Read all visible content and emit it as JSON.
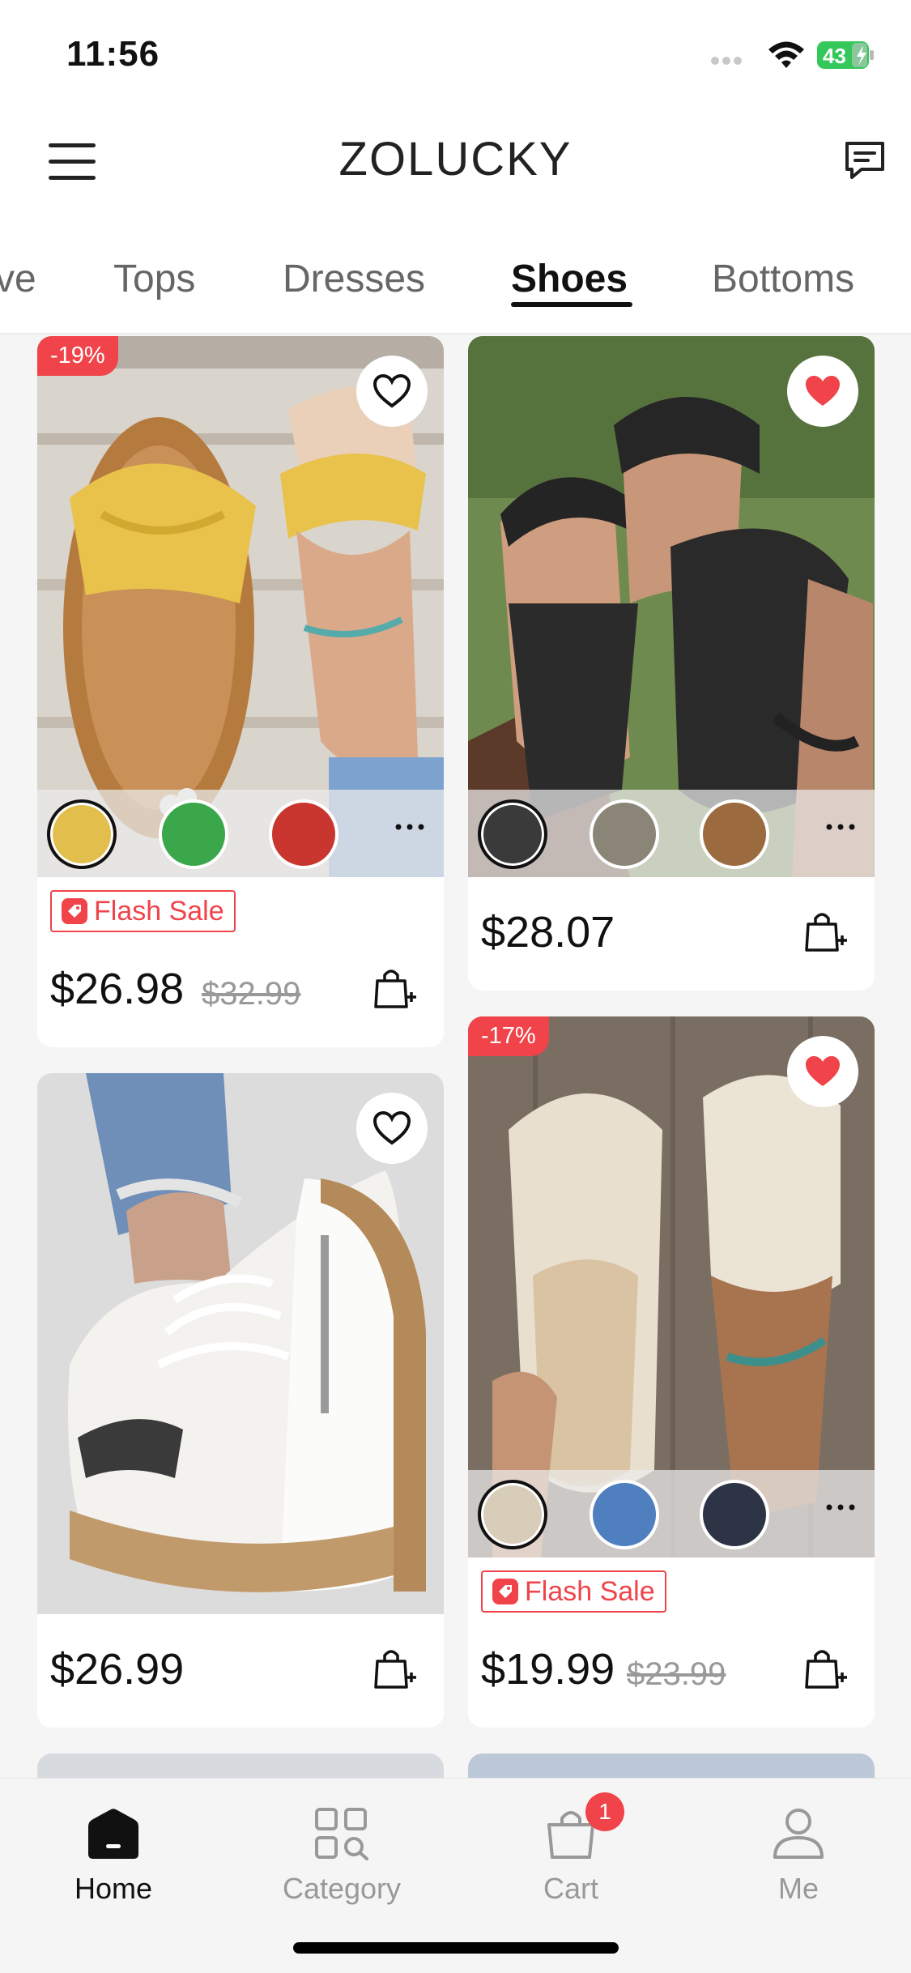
{
  "status_bar": {
    "time": "11:56",
    "battery": "43"
  },
  "header": {
    "title": "ZOLUCKY"
  },
  "tabs": [
    {
      "label": "ve"
    },
    {
      "label": "Tops"
    },
    {
      "label": "Dresses"
    },
    {
      "label": "Shoes"
    },
    {
      "label": "Bottoms"
    }
  ],
  "active_tab": "Shoes",
  "products": [
    {
      "discount": "-19%",
      "flash_label": "Flash Sale",
      "price": "$26.98",
      "original_price": "$32.99",
      "wishlisted": false,
      "swatches": [
        "yellow",
        "green",
        "red"
      ]
    },
    {
      "discount": "",
      "flash_label": "",
      "price": "$28.07",
      "original_price": "",
      "wishlisted": true,
      "swatches": [
        "black",
        "grey",
        "brown"
      ]
    },
    {
      "discount": "",
      "flash_label": "",
      "price": "$26.99",
      "original_price": "",
      "wishlisted": false,
      "swatches": []
    },
    {
      "discount": "-17%",
      "flash_label": "Flash Sale",
      "price": "$19.99",
      "original_price": "$23.99",
      "wishlisted": true,
      "swatches": [
        "beige",
        "blue",
        "black"
      ]
    }
  ],
  "bottom_nav": [
    {
      "label": "Home",
      "icon": "home-icon",
      "active": true
    },
    {
      "label": "Category",
      "icon": "category-icon",
      "active": false
    },
    {
      "label": "Cart",
      "icon": "cart-icon",
      "active": false,
      "badge": "1"
    },
    {
      "label": "Me",
      "icon": "profile-icon",
      "active": false
    }
  ],
  "colors": {
    "accent_red": "#f0434a",
    "text_primary": "#111111",
    "text_muted": "#999999"
  }
}
